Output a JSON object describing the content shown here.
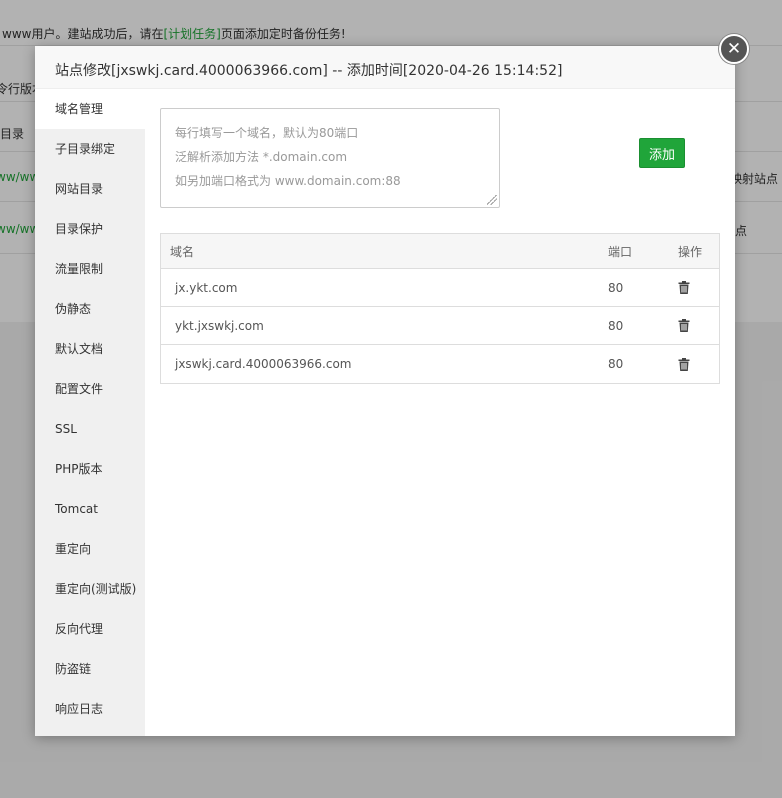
{
  "background": {
    "notice_prefix": "www用户。建站成功后，请在",
    "notice_link": "[计划任务]",
    "notice_suffix": "页面添加定时备份任务!",
    "row1_text": "令行版本",
    "row2_text": "目录",
    "row3_left": "ww/www",
    "row3_right": "映射站点",
    "row4_left": "ww/www",
    "row4_right": "点"
  },
  "modal": {
    "title": "站点修改[jxswkj.card.4000063966.com] -- 添加时间[2020-04-26 15:14:52]",
    "close_symbol": "✕"
  },
  "sidebar": {
    "items": [
      {
        "label": "域名管理"
      },
      {
        "label": "子目录绑定"
      },
      {
        "label": "网站目录"
      },
      {
        "label": "目录保护"
      },
      {
        "label": "流量限制"
      },
      {
        "label": "伪静态"
      },
      {
        "label": "默认文档"
      },
      {
        "label": "配置文件"
      },
      {
        "label": "SSL"
      },
      {
        "label": "PHP版本"
      },
      {
        "label": "Tomcat"
      },
      {
        "label": "重定向"
      },
      {
        "label": "重定向(测试版)"
      },
      {
        "label": "反向代理"
      },
      {
        "label": "防盗链"
      },
      {
        "label": "响应日志"
      }
    ],
    "active_index": 0
  },
  "domain_form": {
    "placeholder_lines": [
      "每行填写一个域名，默认为80端口",
      "泛解析添加方法 *.domain.com",
      "如另加端口格式为 www.domain.com:88"
    ],
    "add_label": "添加"
  },
  "domain_table": {
    "headers": {
      "domain": "域名",
      "port": "端口",
      "op": "操作"
    },
    "rows": [
      {
        "domain": "jx.ykt.com",
        "port": "80"
      },
      {
        "domain": "ykt.jxswkj.com",
        "port": "80"
      },
      {
        "domain": "jxswkj.card.4000063966.com",
        "port": "80"
      }
    ]
  },
  "icons": {
    "delete": "trash-icon",
    "close": "close-icon"
  },
  "colors": {
    "accent": "#20a53a",
    "sidebar_bg": "#f0f0f0"
  }
}
